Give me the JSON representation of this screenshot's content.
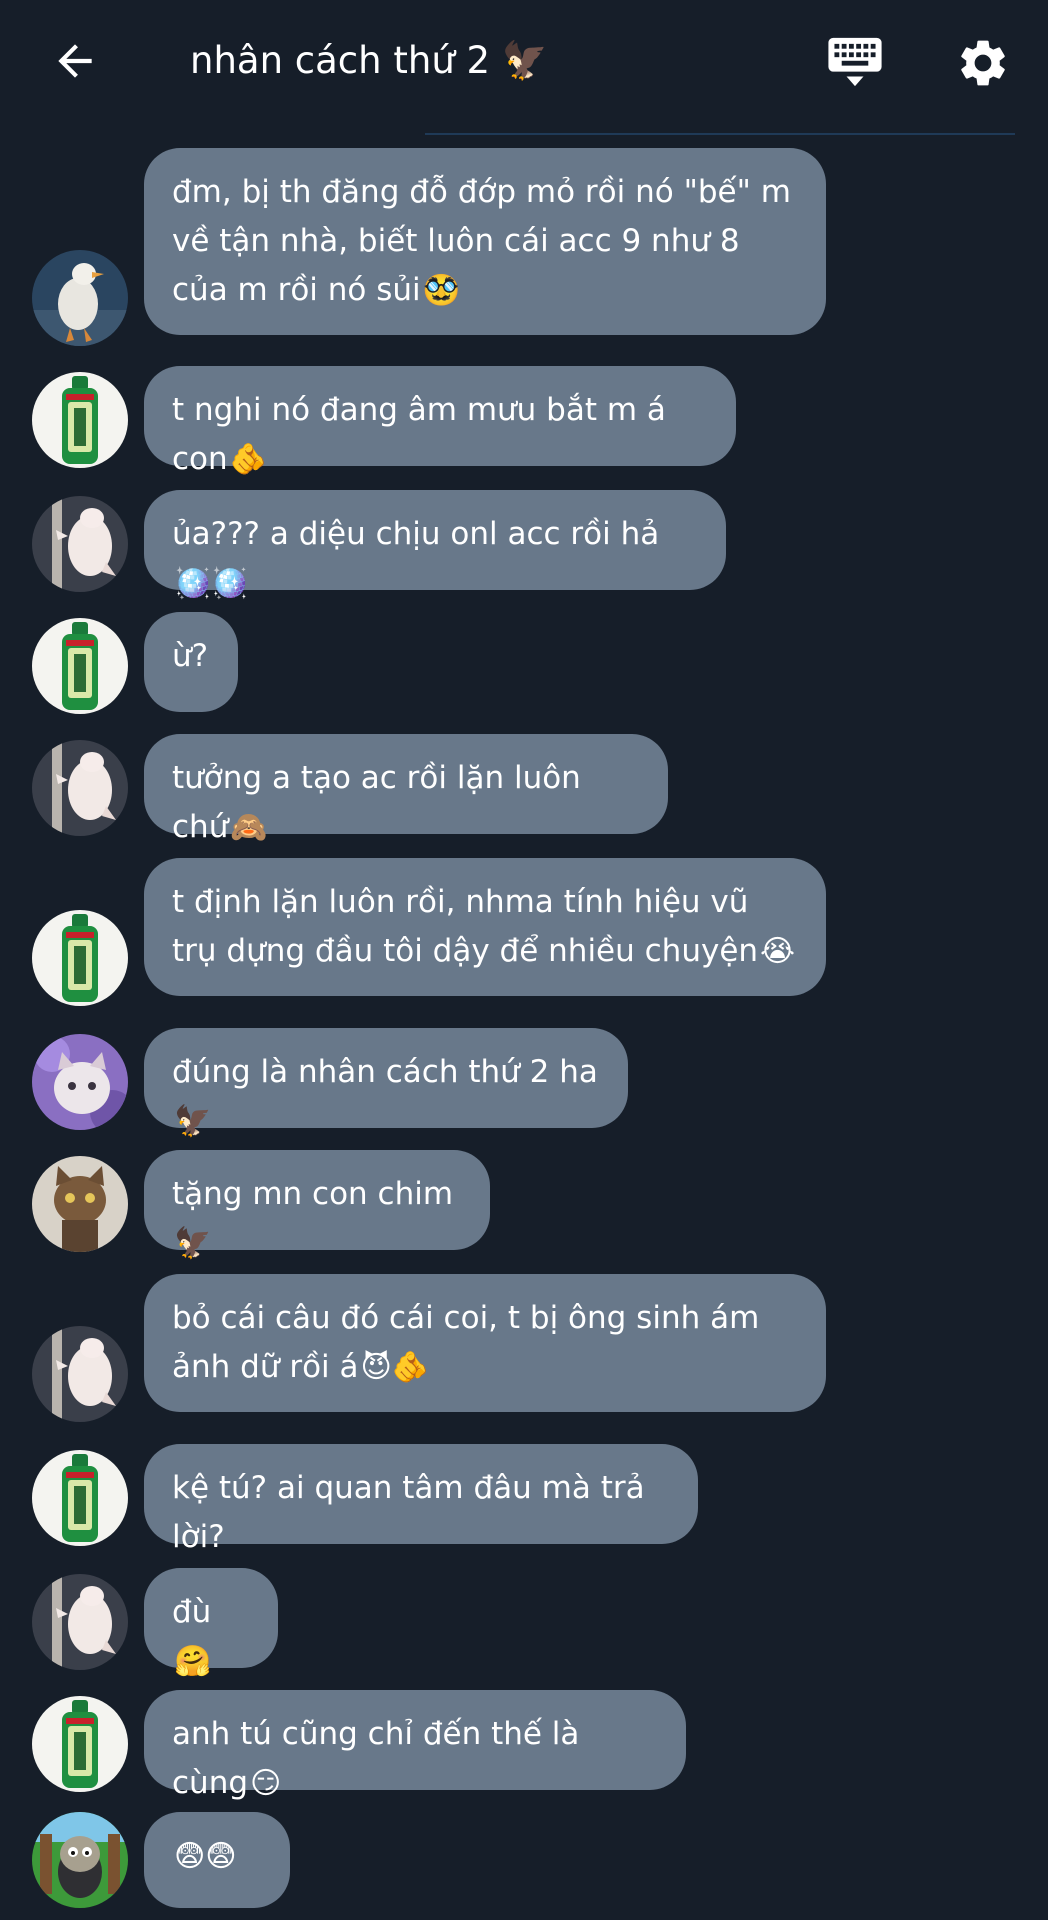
{
  "header": {
    "title": "nhân cách thứ 2",
    "title_emoji": "🦅"
  },
  "colors": {
    "background": "#161e29",
    "bubble": "#68788a",
    "text": "#ffffff"
  },
  "messages": [
    {
      "avatar": "duck-avatar",
      "text": "đm, bị th đăng đỗ đớp mỏ rồi nó \"bế\" m về tận nhà, biết luôn cái acc 9 như 8 của m rồi nó sủi",
      "emoji": "🥸"
    },
    {
      "avatar": "green-bottle-avatar",
      "text": "t nghi nó đang âm mưu bắt m á con",
      "emoji": "🫵"
    },
    {
      "avatar": "pole-cat-avatar",
      "text": "ủa??? a diệu chịu onl acc rồi hả",
      "emoji": "🪩🪩"
    },
    {
      "avatar": "green-bottle-avatar",
      "text": "ừ?",
      "emoji": ""
    },
    {
      "avatar": "pole-cat-avatar",
      "text": "tưởng a tạo ac rồi lặn luôn chứ",
      "emoji": "🙈"
    },
    {
      "avatar": "green-bottle-avatar",
      "text": "t định lặn luôn rồi, nhma tính hiệu vũ trụ dựng đầu tôi dậy để nhiều chuyện",
      "emoji": "😭"
    },
    {
      "avatar": "purple-cat-avatar",
      "text": "đúng là nhân cách thứ 2 ha",
      "emoji": "🦅"
    },
    {
      "avatar": "brown-cat-avatar",
      "text": "tặng mn con chim",
      "emoji": "🦅"
    },
    {
      "avatar": "pole-cat-avatar",
      "text": "bỏ cái câu đó cái coi, t bị ông sinh ám ảnh dữ rồi á",
      "emoji": "😈🫵"
    },
    {
      "avatar": "green-bottle-avatar",
      "text": "kệ tú? ai quan tâm đâu mà trả lời?",
      "emoji": ""
    },
    {
      "avatar": "pole-cat-avatar",
      "text": "đù",
      "emoji": "🤗"
    },
    {
      "avatar": "green-bottle-avatar",
      "text": "anh tú cũng chỉ đến thế là cùng",
      "emoji": "😏"
    },
    {
      "avatar": "sheep-avatar",
      "text": "",
      "emoji": "😨😨"
    }
  ]
}
